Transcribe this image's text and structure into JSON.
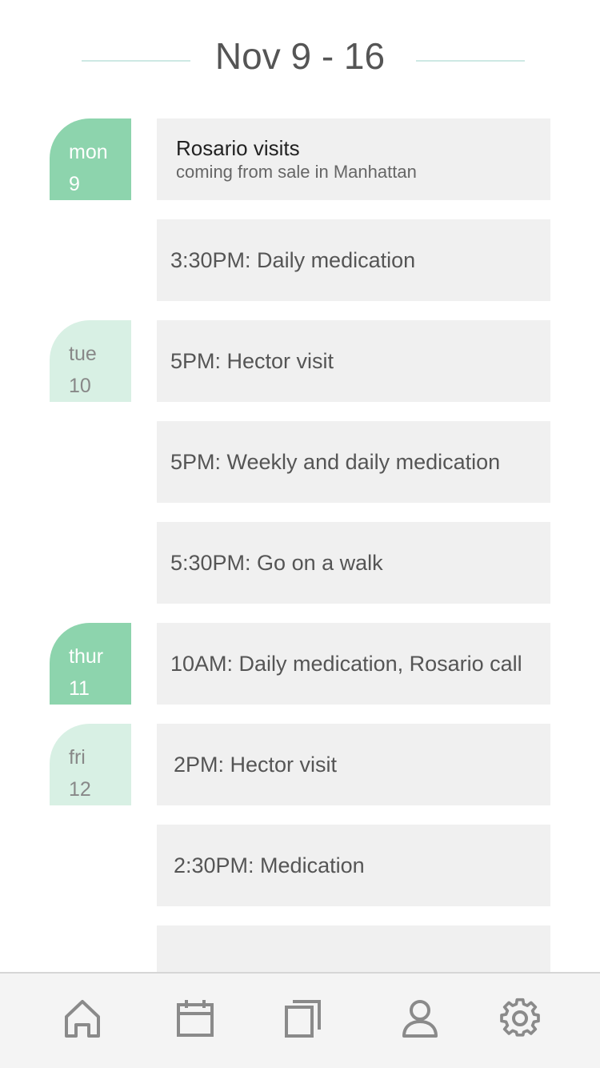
{
  "header": {
    "title": "Nov 9 - 16"
  },
  "days": [
    {
      "weekday": "mon",
      "date": "9"
    },
    {
      "weekday": "tue",
      "date": "10"
    },
    {
      "weekday": "thur",
      "date": "11"
    },
    {
      "weekday": "fri",
      "date": "12"
    }
  ],
  "events": [
    {
      "title": "Rosario visits",
      "subtitle": "coming from sale in Manhattan"
    },
    {
      "text": "3:30PM: Daily medication"
    },
    {
      "text": "5PM: Hector visit"
    },
    {
      "text": "5PM: Weekly and daily medication"
    },
    {
      "text": "5:30PM: Go on a walk"
    },
    {
      "text": "10AM: Daily medication, Rosario call"
    },
    {
      "text": "2PM: Hector visit"
    },
    {
      "text": "2:30PM: Medication"
    },
    {
      "text": ""
    }
  ],
  "tabbar": {
    "icons": [
      "home-icon",
      "calendar-icon",
      "documents-icon",
      "profile-icon",
      "settings-icon"
    ]
  },
  "colors": {
    "active_day": "#8dd4ad",
    "inactive_day": "#d8f0e4",
    "event_bg": "#f0f0f0",
    "header_line": "#cde9e4",
    "icon": "#8a8a8a"
  }
}
